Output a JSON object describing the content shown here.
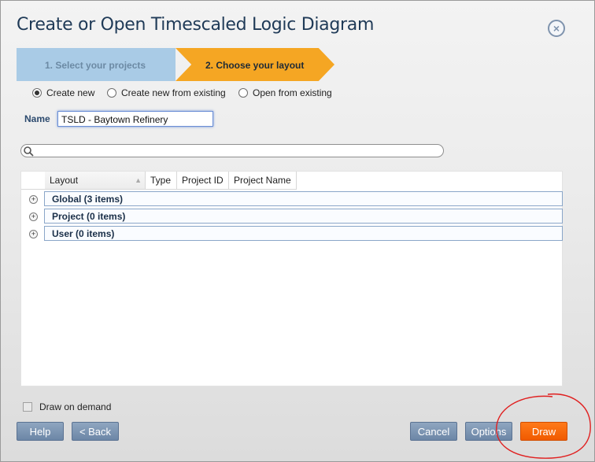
{
  "dialog": {
    "title": "Create or Open Timescaled Logic Diagram",
    "close_icon": "close-icon"
  },
  "wizard": {
    "steps": [
      {
        "label": "1. Select your projects",
        "active": false
      },
      {
        "label": "2. Choose your layout",
        "active": true
      }
    ]
  },
  "mode": {
    "options": [
      "Create new",
      "Create new from existing",
      "Open from existing"
    ],
    "selected": "Create new"
  },
  "name_field": {
    "label": "Name",
    "value": "TSLD - Baytown Refinery"
  },
  "search": {
    "icon": "search-icon",
    "placeholder": ""
  },
  "grid": {
    "columns": [
      "Layout",
      "Type",
      "Project ID",
      "Project Name"
    ],
    "groups": [
      {
        "label": "Global (3 items)"
      },
      {
        "label": "Project (0 items)"
      },
      {
        "label": "User (0 items)"
      }
    ]
  },
  "footer": {
    "draw_on_demand_label": "Draw on demand",
    "draw_on_demand_checked": false,
    "help": "Help",
    "back": "< Back",
    "cancel": "Cancel",
    "options": "Options",
    "draw": "Draw"
  },
  "colors": {
    "accent_orange": "#f5a623",
    "draw_button": "#f05a00",
    "step_inactive": "#a9cbe6",
    "annotation": "#e02020"
  }
}
